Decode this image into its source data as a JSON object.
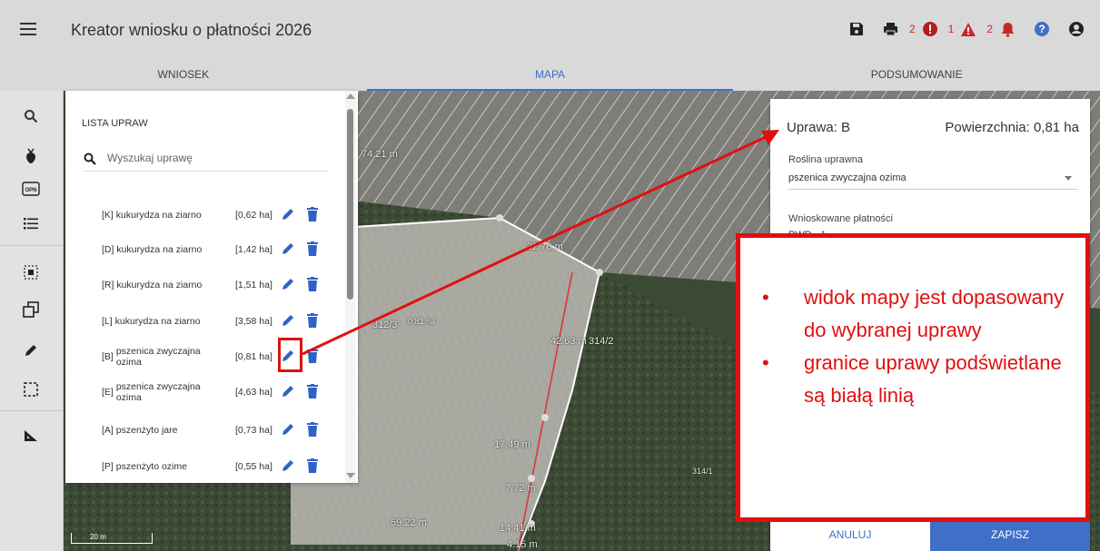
{
  "app": {
    "title": "Kreator wniosku o płatności 2026"
  },
  "toolbar": {
    "count_errors": "2",
    "count_warnings": "1",
    "count_notifications": "2"
  },
  "tabs": [
    {
      "label": "WNIOSEK"
    },
    {
      "label": "MAPA"
    },
    {
      "label": "PODSUMOWANIE"
    }
  ],
  "active_tab": "MAPA",
  "rail": {
    "opn_label": "OPN"
  },
  "crop_list": {
    "title": "LISTA UPRAW",
    "search_placeholder": "Wyszukaj uprawę",
    "items": [
      {
        "code": "[K]",
        "name": "kukurydza na ziarno",
        "area": "[0,62 ha]"
      },
      {
        "code": "[D]",
        "name": "kukurydza na ziarno",
        "area": "[1,42 ha]"
      },
      {
        "code": "[R]",
        "name": "kukurydza na ziarno",
        "area": "[1,51 ha]"
      },
      {
        "code": "[L]",
        "name": "kukurydza na ziarno",
        "area": "[3,58 ha]"
      },
      {
        "code": "[B]",
        "name": "pszenica zwyczajna ozima",
        "area": "[0,81 ha]"
      },
      {
        "code": "[E]",
        "name": "pszenica zwyczajna ozima",
        "area": "[4,63 ha]"
      },
      {
        "code": "[A]",
        "name": "pszenżyto jare",
        "area": "[0,73 ha]"
      },
      {
        "code": "[P]",
        "name": "pszenżyto ozime",
        "area": "[0,55 ha]"
      }
    ]
  },
  "map": {
    "labels": [
      "74.21 m",
      "32.76 m",
      "312/3",
      "0.81 ha",
      "42.63 m",
      "314/2",
      "17.49 m",
      "7.72 m",
      "59.22 m",
      "14.41 m",
      "4.15 m",
      "314/1"
    ],
    "scale": "20 m"
  },
  "detail": {
    "crop_label": "Uprawa: B",
    "area_label": "Powierzchnia: 0,81 ha",
    "plant_label": "Roślina uprawna",
    "plant_value": "pszenica zwyczajna ozima",
    "payments_label": "Wnioskowane płatności",
    "payments_value": "PWD - 1 ....",
    "cancel": "ANULUJ",
    "save": "ZAPISZ"
  },
  "callout": {
    "bullets": [
      "widok mapy jest dopasowany do wybranej uprawy",
      "granice uprawy podświetlane są białą linią"
    ]
  },
  "colors": {
    "accent": "#3f6fc6",
    "annotation": "#e01010",
    "error": "#c62828"
  }
}
